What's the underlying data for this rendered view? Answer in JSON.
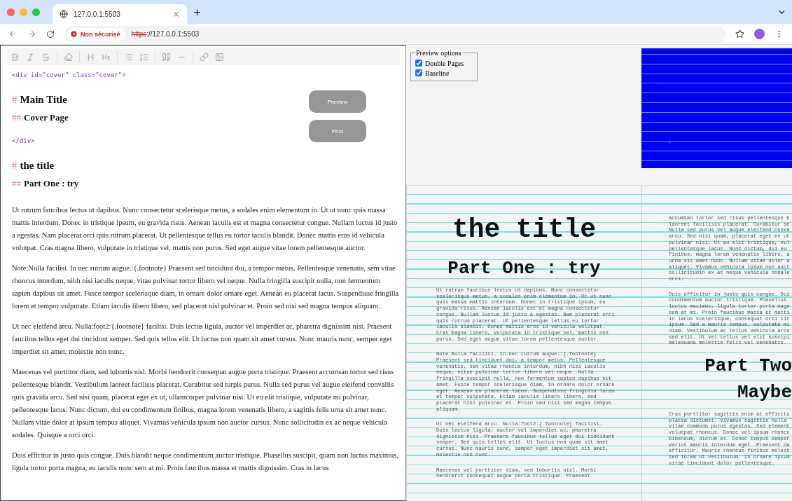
{
  "browser": {
    "tab_title": "127.0.0.1:5503",
    "security": "Non sécurisé",
    "url_scheme": "https",
    "url_rest": "://127.0.0.1:5503"
  },
  "editor": {
    "lines": [
      {
        "kind": "html",
        "text": "<div id=\"cover\" class=\"cover\">"
      },
      {
        "kind": "h1",
        "marker": "#",
        "text": "Main Title"
      },
      {
        "kind": "h2",
        "marker": "##",
        "text": "Cover Page"
      },
      {
        "kind": "html",
        "text": "</div>"
      },
      {
        "kind": "h1",
        "marker": "#",
        "text": "the title"
      },
      {
        "kind": "h2",
        "marker": "##",
        "text": "Part One : try"
      },
      {
        "kind": "para",
        "text": "Ut rutrum faucibus lectus ut dapibus. Nunc consectetur scelerisque metus, a sodales enim elementum in. Ut ut nunc quis massa mattis interdum. Donec in tristique ipsum, eu gravida risus. Aenean iaculis est et magna consectetur congue. Nullam luctus id justo a egestas. Nam placerat orci quis rutrum placerat. Ut pellentesque tellus eu tortor iaculis blandit. Donec mattis eros id vehicula volutpat. Cras magna libero, vulputate in tristique vel, mattis non purus. Sed eget augue vitae lorem pellentesque auctor."
      },
      {
        "kind": "para",
        "text": "Note:Nulla facilisi. In nec rutrum augue.:{.footnote} Praesent sed tincidunt dui, a tempor metus. Pellentesque venenatis, sem vitae rhoncus interdum, nibh nisi iaculis neque, vitae pulvinar tortor libero vel neque. Nulla fringilla suscipit nulla, non fermentum sapien dapibus sit amet. Fusce tempor scelerisque diam, in ornare dolor ornare eget. Aenean eu placerat lacus. Suspendisse fringilla lorem et tempor vulputate. Etiam iaculis libero libero, sed placerat nisl pulvinar et. Proin sed nisi sed magna tempus aliquam."
      },
      {
        "kind": "para",
        "text": "Ut nec eleifend arcu. Nulla:foot2:{.footnote} facilisi. Duis lectus ligula, auctor vel imperdiet ac, pharetra dignissim nisi. Praesent faucibus tellus eget dui tincidunt semper. Sed quis tellus elit. Ut luctus non quam sit amet cursus. Nunc mauris nunc, semper eget imperdiet sit amet, molestie non nunc."
      },
      {
        "kind": "para",
        "text": "Maecenas vel porttitor diam, sed lobortis nisl. Morbi hendrerit consequat augue porta tristique. Praesent accumsan tortor sed risus pellentesque blandit. Vestibulum laoreet facilisis placerat. Curabitur sed turpis purus. Nulla sed purus vel augue eleifend convallis quis gravida arcu. Sed nisi quam, placerat eget ex ut, ullamcorper pulvinar nisi. Ut eu elit tristique, vulputate mi pulvinar, pellentesque lacus. Nunc dictum, dui eu condimentum finibus, magna lorem venenatis libero, a sagittis felis urna sit amet nunc. Nullam vitae dolor at ipsum tempus aliquet. Vivamus vehicula ipsum non auctor cursus. Nunc sollicitudin ex ac neque vehicula sodales. Quisque a orci orci."
      },
      {
        "kind": "para",
        "text": "Duis efficitur in justo quis congue. Duis blandit neque condimentum auctor tristique. Phasellus suscipit, quam non luctus maximus, ligula tortor porta magna, eu iaculis nunc sem at mi. Proin faucibus massa et mattis dignissim. Cras in lacus"
      }
    ],
    "floating_buttons": [
      "Preview",
      "Print"
    ]
  },
  "preview": {
    "options": {
      "legend": "Preview options",
      "items": [
        {
          "label": "Double Pages",
          "checked": true
        },
        {
          "label": "Baseline",
          "checked": true
        }
      ]
    },
    "cover_page_number": "1",
    "pages": [
      {
        "blocks": [
          {
            "kind": "title",
            "text": "the title"
          },
          {
            "kind": "heading",
            "text": "Part One : try"
          },
          {
            "kind": "para",
            "text": "Ut rutrum faucibus lectus ut dapibus. Nunc consectetur\nscelerisque metus, a sodales enim elementum in. Ut ut nunc\nquis massa mattis interdum. Donec in tristique ipsum, eu\ngravida risus. Aenean iaculis est et magna consectetur\ncongue. Nullam luctus id justo a egestas. Nam placerat orci\nquis rutrum placerat. Ut pellentesque tellus eu tortor\niaculis blandit. Donec mattis eros id vehicula volutpat.\nCras magna libero, vulputate in tristique vel, mattis non\npurus. Sed eget augue vitae lorem pellentesque auctor."
          },
          {
            "kind": "para",
            "text": "Note:Nulla facilisi. In nec rutrum augue.:{.footnote}\nPraesent sed tincidunt dui, a tempor metus. Pellentesque\nvenenatis, sem vitae rhoncus interdum, nibh nisi iaculis\nneque, vitae pulvinar tortor libero vel neque. Nulla\nfringilla suscipit nulla, non fermentum sapien dapibus sit\namet. Fusce tempor scelerisque diam, in ornare dolor ornare\neget. Aenean eu placerat lacus. Suspendisse fringilla lorem\net tempor vulputate. Etiam iaculis libero libero, sed\nplacerat nisl pulvinar et. Proin sed nisi sed magna tempus\naliquam."
          },
          {
            "kind": "para",
            "text": "Ut nec eleifend arcu. Nulla:foot2:{.footnote} facilisi.\nDuis lectus ligula, auctor vel imperdiet ac, pharetra\ndignissim nisi. Praesent faucibus tellus eget dui tincidunt\nsemper. Sed quis tellus elit. Ut luctus non quam sit amet\ncursus. Nunc mauris nunc, semper eget imperdiet sit amet,\nmolestie non nunc."
          },
          {
            "kind": "para",
            "text": "Maecenas vel porttitor diam, sed lobortis nisl. Morbi\nhendrerit consequat augue porta tristique. Praesent"
          }
        ]
      },
      {
        "blocks": [
          {
            "kind": "para",
            "text": "accumsan tortor sed risus pellentesque b\nlaoreet facilisis placerat. Curabitur se\nNulla sed purus vel augue eleifend conva\narcu. Sed nisi quam, placerat eget ex ut\npulvinar nisi. Ut eu elit tristique, vul\npellentesque lacus. Nunc dictum, dui eu\nfinibus, magna lorem venenatis libero, a\nurna sit amet nunc. Nullam vitae dolor a\naliquet. Vivamus vehicula ipsum non auct\nsollicitudin ex ac neque vehicula sodale\norci."
          },
          {
            "kind": "para",
            "text": "Duis efficitur in justo quis congue. Dui\ncondimentum auctor tristique. Phasellus\nluctus maximus, ligula tortor porta magn\nsem at mi. Proin faucibus massa et matti\nin lacus scelerisque, consequat orci sit\nipsum. Sed a mauris tempus, vulputate mi\ndiam. Vestibulum ac tellus vehicula arcu\nsed elit. Ut vel tellus vel elit suscipi\nmalesuada molestie felis vel venenatis."
          },
          {
            "kind": "heading",
            "text": "Part Two"
          },
          {
            "kind": "heading",
            "text": "Maybe"
          },
          {
            "kind": "para",
            "text": "Cras porttitor sagittis enim at efficitu\nplatea dictumst. Vivamus sagittis nulla\nvitae commodo purus egestas. Sed element\nvolutpat rhoncus. Donec vel ipsum rhoncu\nbibendum, dictum ex. Donec tempus semper\nvarius mauris interdum eget. Praesent da\nefficitur. Mauris rhoncus finibus molest\nsed lorem ut vestibulum. In ornare ipsum\nvitae tincidunt dolor pellentesque."
          }
        ]
      }
    ]
  }
}
